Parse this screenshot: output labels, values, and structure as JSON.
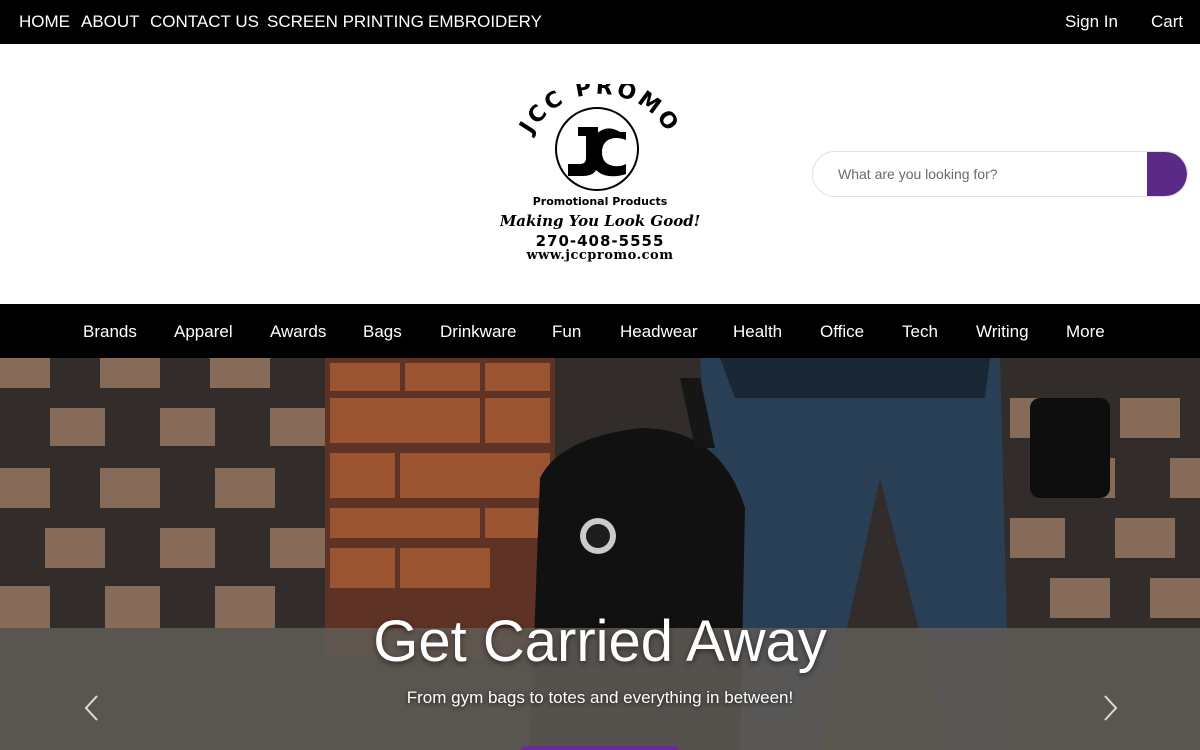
{
  "top_nav": {
    "items": [
      "HOME",
      "ABOUT",
      "CONTACT US",
      "SCREEN PRINTING",
      "EMBROIDERY"
    ],
    "sign_in": "Sign In",
    "cart": "Cart"
  },
  "logo": {
    "brand": "JCC PROMO",
    "tagline_1": "Promotional Products",
    "tagline_2": "Making You Look Good!",
    "phone": "270-408-5555",
    "url": "www.jccpromo.com"
  },
  "search": {
    "placeholder": "What are you looking for?",
    "button_color": "#5b2a86"
  },
  "category_nav": {
    "items": [
      "Brands",
      "Apparel",
      "Awards",
      "Bags",
      "Drinkware",
      "Fun",
      "Headwear",
      "Health",
      "Office",
      "Tech",
      "Writing",
      "More"
    ]
  },
  "hero": {
    "title": "Get Carried Away",
    "subtitle": "From gym bags to totes and everything in between!"
  },
  "colors": {
    "bar_background": "#000000",
    "accent": "#5b2a86"
  }
}
